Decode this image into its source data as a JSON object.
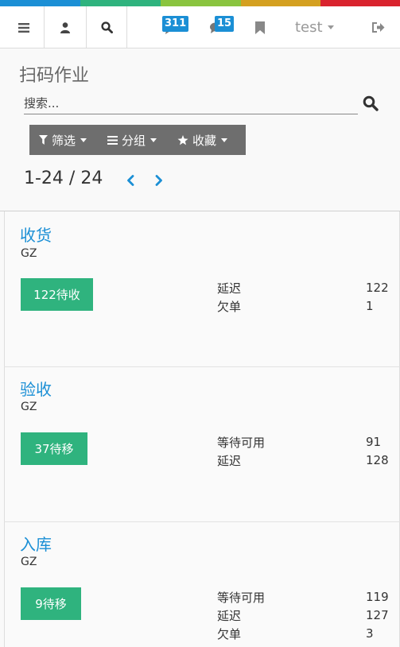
{
  "colors": {
    "bar": [
      "#1b8fd5",
      "#2fb37e",
      "#8ac43f",
      "#d4a020",
      "#d9232e"
    ],
    "accent": "#1b8fd5",
    "button": "#2fb37e",
    "filter_bg": "#6e6e6e"
  },
  "nav": {
    "icons": [
      "menu-icon",
      "user-icon",
      "search-icon",
      "chat-icon",
      "comments-icon",
      "bookmark-icon",
      "logout-icon"
    ],
    "messages_badge": "311",
    "activities_badge": "15",
    "user_name": "test"
  },
  "page": {
    "title": "扫码作业",
    "search_placeholder": "搜索..."
  },
  "filters": {
    "filter_label": "筛选",
    "group_label": "分组",
    "favorites_label": "收藏"
  },
  "pager": {
    "range": "1-24 / 24"
  },
  "cards": [
    {
      "title": "收货",
      "warehouse": "GZ",
      "button_label": "122待收",
      "stats": [
        {
          "label": "延迟",
          "value": "122"
        },
        {
          "label": "欠单",
          "value": "1"
        }
      ]
    },
    {
      "title": "验收",
      "warehouse": "GZ",
      "button_label": "37待移",
      "stats": [
        {
          "label": "等待可用",
          "value": "91"
        },
        {
          "label": "延迟",
          "value": "128"
        }
      ]
    },
    {
      "title": "入库",
      "warehouse": "GZ",
      "button_label": "9待移",
      "stats": [
        {
          "label": "等待可用",
          "value": "119"
        },
        {
          "label": "延迟",
          "value": "127"
        },
        {
          "label": "欠单",
          "value": "3"
        }
      ]
    }
  ]
}
